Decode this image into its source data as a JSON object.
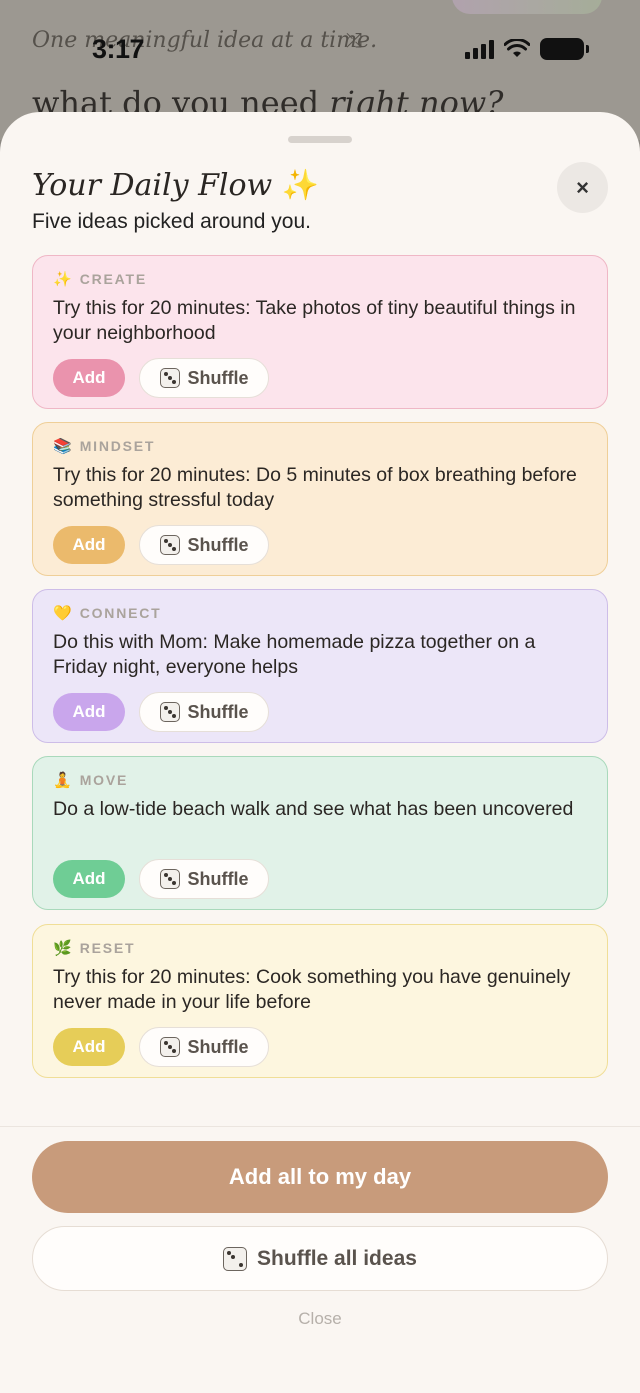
{
  "status_bar": {
    "time": "3:17"
  },
  "background_app": {
    "tagline": "One meaningful idea at a time.",
    "question_prefix": "what do you need ",
    "question_emphasis": "right now?"
  },
  "sheet": {
    "title": "Your Daily Flow",
    "title_emoji": "✨",
    "subtitle": "Five ideas picked around you.",
    "close_icon": "×"
  },
  "cards": [
    {
      "category": "CREATE",
      "icon": "✨",
      "text": "Try this for 20 minutes: Take photos of tiny beautiful things in your neighborhood",
      "add_label": "Add",
      "shuffle_label": "Shuffle",
      "accent": "#ea93ad"
    },
    {
      "category": "MINDSET",
      "icon": "📚",
      "text": "Try this for 20 minutes: Do 5 minutes of box breathing before something stressful today",
      "add_label": "Add",
      "shuffle_label": "Shuffle",
      "accent": "#ebba6c"
    },
    {
      "category": "CONNECT",
      "icon": "💛",
      "text": "Do this with Mom: Make homemade pizza together on a Friday night, everyone helps",
      "add_label": "Add",
      "shuffle_label": "Shuffle",
      "accent": "#c9a6ec"
    },
    {
      "category": "MOVE",
      "icon": "🧘",
      "text": "Do a low-tide beach walk and see what has been uncovered",
      "add_label": "Add",
      "shuffle_label": "Shuffle",
      "accent": "#6fcd95"
    },
    {
      "category": "RESET",
      "icon": "🌿",
      "text": "Try this for 20 minutes: Cook something you have genuinely never made in your life before",
      "add_label": "Add",
      "shuffle_label": "Shuffle",
      "accent": "#e6cd58"
    }
  ],
  "footer": {
    "primary_label": "Add all to my day",
    "secondary_label": "Shuffle all ideas",
    "close_label": "Close"
  }
}
